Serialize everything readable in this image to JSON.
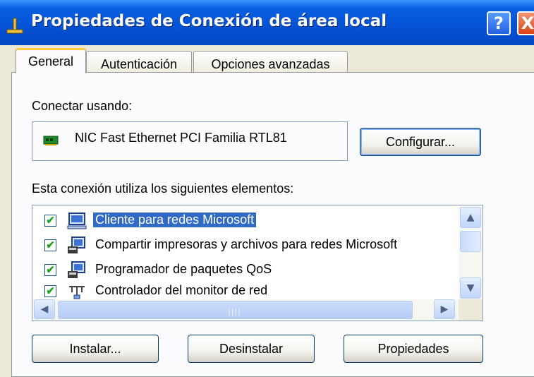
{
  "window": {
    "title": "Propiedades de Conexión de área local",
    "help_label": "?",
    "close_label": "X"
  },
  "tabs": [
    {
      "label": "General",
      "active": true
    },
    {
      "label": "Autenticación",
      "active": false
    },
    {
      "label": "Opciones avanzadas",
      "active": false
    }
  ],
  "connect": {
    "label": "Conectar usando:",
    "adapter_name": "NIC Fast Ethernet PCI Familia RTL81",
    "adapter_icon": "network-card-icon",
    "configure_label": "Configurar..."
  },
  "components": {
    "label": "Esta conexión utiliza los siguientes elementos:",
    "items": [
      {
        "label": "Cliente para redes Microsoft",
        "checked": true,
        "selected": true,
        "icon": "network-client-icon"
      },
      {
        "label": "Compartir impresoras y archivos para redes Microsoft",
        "checked": true,
        "selected": false,
        "icon": "network-service-icon"
      },
      {
        "label": "Programador de paquetes QoS",
        "checked": true,
        "selected": false,
        "icon": "network-service-icon"
      },
      {
        "label": "Controlador del monitor de red",
        "checked": true,
        "selected": false,
        "icon": "protocol-icon"
      }
    ]
  },
  "buttons": {
    "install": "Instalar...",
    "uninstall": "Desinstalar",
    "properties": "Propiedades"
  },
  "colors": {
    "titlebar": "#0453d6",
    "selection": "#316ac5",
    "tab_highlight": "#ffc83c",
    "dialog_bg": "#ece9d8"
  }
}
